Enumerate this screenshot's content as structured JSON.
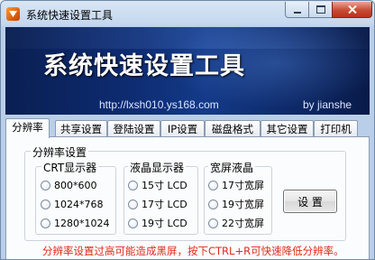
{
  "window": {
    "title": "系统快速设置工具",
    "controls": [
      "minimize",
      "maximize",
      "close"
    ]
  },
  "banner": {
    "title": "系统快速设置工具",
    "url": "http://lxsh010.ys168.com",
    "author": "by  jianshe"
  },
  "tabs": [
    {
      "label": "分辨率",
      "active": true
    },
    {
      "label": "共享设置",
      "active": false
    },
    {
      "label": "登陆设置",
      "active": false
    },
    {
      "label": "IP设置",
      "active": false
    },
    {
      "label": "磁盘格式",
      "active": false
    },
    {
      "label": "其它设置",
      "active": false
    },
    {
      "label": "打印机",
      "active": false
    }
  ],
  "resolution": {
    "group_title": "分辨率设置",
    "crt": {
      "title": "CRT显示器",
      "options": [
        "800*600",
        "1024*768",
        "1280*1024"
      ]
    },
    "lcd": {
      "title": "液晶显示器",
      "options": [
        "15寸 LCD",
        "17寸 LCD",
        "19寸 LCD"
      ]
    },
    "wide": {
      "title": "宽屏液晶",
      "options": [
        "17寸宽屏",
        "19寸宽屏",
        "22寸宽屏"
      ]
    },
    "set_button": "设 置",
    "warning": "分辨率设置过高可能造成黑屏，按下CTRL+R可快速降低分辨率。"
  },
  "colors": {
    "banner_bg": "#0e2c72",
    "warning": "#e02a1a",
    "close_button": "#c84a32"
  }
}
